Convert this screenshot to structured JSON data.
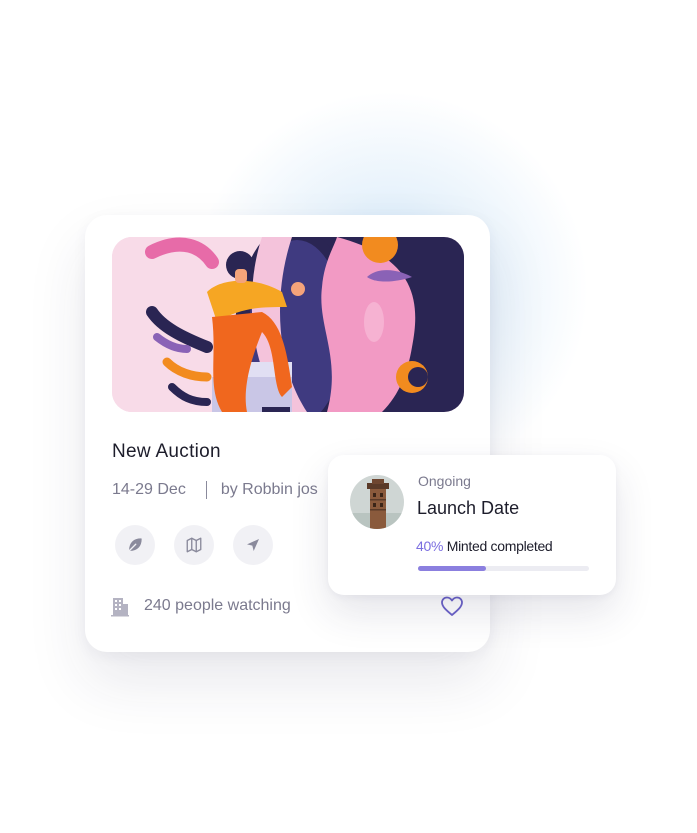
{
  "card": {
    "title": "New Auction",
    "date": "14-29 Dec",
    "author": "by Robbin jos",
    "actions": [
      {
        "icon": "leaf-icon"
      },
      {
        "icon": "map-icon"
      },
      {
        "icon": "send-icon"
      }
    ],
    "watching_text": "240 people watching",
    "like_icon": "heart-icon"
  },
  "popup": {
    "status": "Ongoing",
    "title": "Launch Date",
    "progress_percent_label": "40%",
    "progress_label": "Minted completed",
    "progress_fraction": 0.4
  },
  "colors": {
    "accent": "#8b7fdf",
    "text_dark": "#1d1d2b",
    "text_muted": "#7b7a8e",
    "art_background": "#f8dbe8"
  }
}
